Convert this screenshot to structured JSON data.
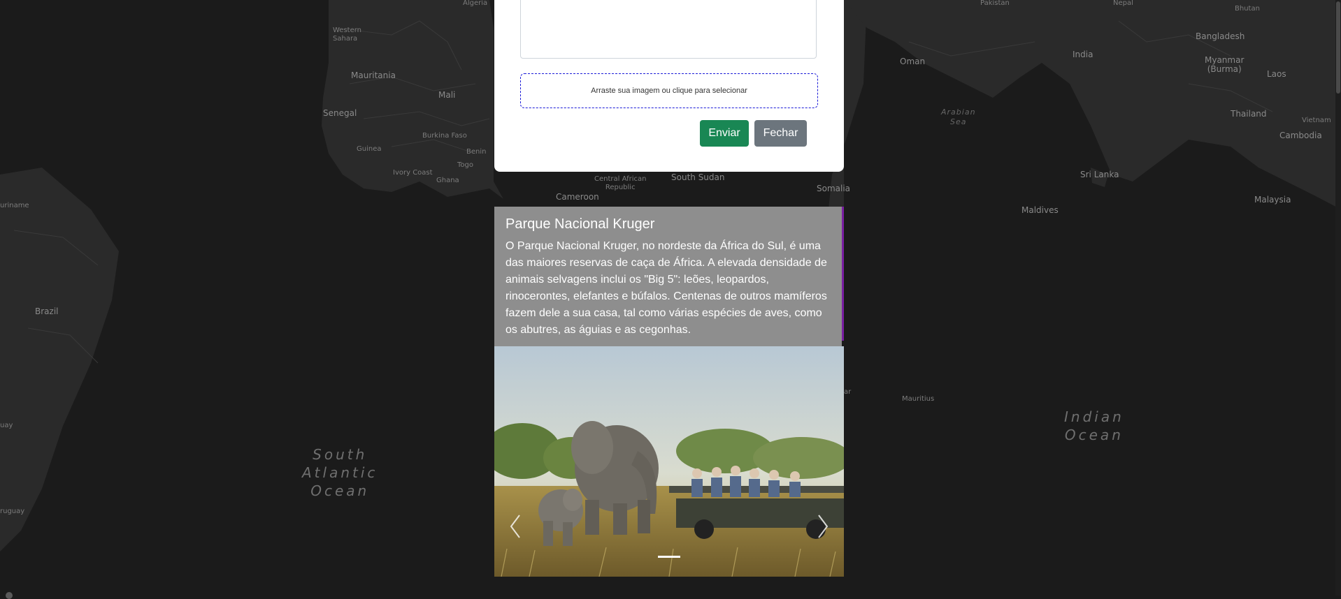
{
  "map": {
    "countries": [
      {
        "key": "algeria",
        "label": "Algeria"
      },
      {
        "key": "western_sahara",
        "label": "Western\nSahara"
      },
      {
        "key": "mauritania",
        "label": "Mauritania"
      },
      {
        "key": "mali",
        "label": "Mali"
      },
      {
        "key": "senegal",
        "label": "Senegal"
      },
      {
        "key": "burkina_faso",
        "label": "Burkina Faso"
      },
      {
        "key": "guinea",
        "label": "Guinea"
      },
      {
        "key": "benin",
        "label": "Benin"
      },
      {
        "key": "togo",
        "label": "Togo"
      },
      {
        "key": "ivory_coast",
        "label": "Ivory Coast"
      },
      {
        "key": "ghana",
        "label": "Ghana"
      },
      {
        "key": "car",
        "label": "Central African\nRepublic"
      },
      {
        "key": "south_sudan",
        "label": "South Sudan"
      },
      {
        "key": "cameroon",
        "label": "Cameroon"
      },
      {
        "key": "somalia",
        "label": "Somalia"
      },
      {
        "key": "suriname",
        "label": "uriname"
      },
      {
        "key": "brazil",
        "label": "Brazil"
      },
      {
        "key": "paraguay",
        "label": "uay"
      },
      {
        "key": "uruguay",
        "label": "ruguay"
      },
      {
        "key": "oman",
        "label": "Oman"
      },
      {
        "key": "pakistan",
        "label": "Pakistan"
      },
      {
        "key": "nepal",
        "label": "Nepal"
      },
      {
        "key": "bhutan",
        "label": "Bhutan"
      },
      {
        "key": "bangladesh",
        "label": "Bangladesh"
      },
      {
        "key": "india",
        "label": "India"
      },
      {
        "key": "myanmar",
        "label": "Myanmar\n(Burma)"
      },
      {
        "key": "laos",
        "label": "Laos"
      },
      {
        "key": "thailand",
        "label": "Thailand"
      },
      {
        "key": "vietnam",
        "label": "Vietnam"
      },
      {
        "key": "cambodia",
        "label": "Cambodia"
      },
      {
        "key": "sri_lanka",
        "label": "Sri Lanka"
      },
      {
        "key": "maldives",
        "label": "Maldives"
      },
      {
        "key": "malaysia",
        "label": "Malaysia"
      },
      {
        "key": "mauritius",
        "label": "Mauritius"
      },
      {
        "key": "madagascar_fragment",
        "label": "ar"
      }
    ],
    "oceans": {
      "south_atlantic": "South\nAtlantic\nOcean",
      "indian": "Indian\nOcean",
      "arabian_sea": "Arabian\nSea"
    }
  },
  "form": {
    "dropzone_text": "Arraste sua imagem ou clique para selecionar",
    "send_label": "Enviar",
    "close_label": "Fechar"
  },
  "card": {
    "title": "Parque Nacional Kruger",
    "description": "O Parque Nacional Kruger, no nordeste da África do Sul, é uma das maiores reservas de caça de África. A elevada densidade de animais selvagens inclui os \"Big 5\": leões, leopardos, rinocerontes, elefantes e búfalos. Centenas de outros mamíferos fazem dele a sua casa, tal como várias espécies de aves, como os abutres, as águias e as cegonhas.",
    "prev_icon": "chevron-left-icon",
    "next_icon": "chevron-right-icon"
  },
  "colors": {
    "send": "#198754",
    "close": "#6c757d",
    "accent": "#7a1fa2",
    "caption_bg": "#8e8e8e"
  }
}
